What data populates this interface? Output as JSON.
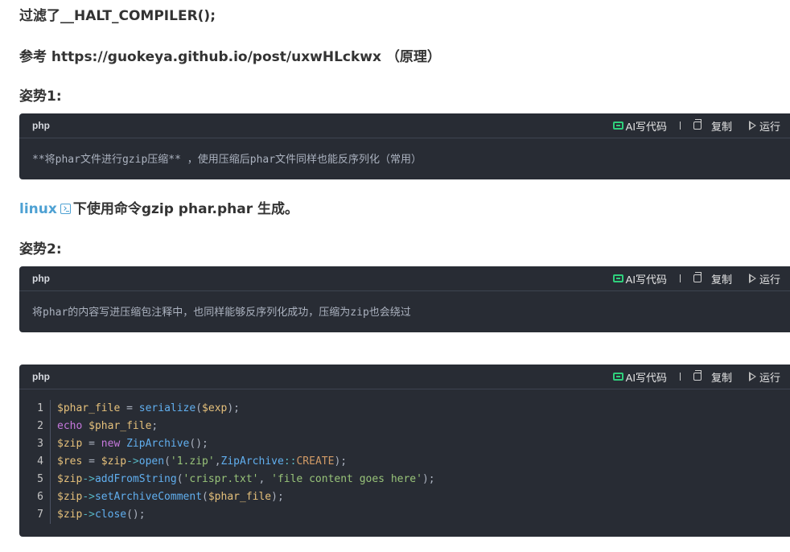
{
  "headings": {
    "h1": "过滤了__HALT_COMPILER();",
    "h2": "参考 https://guokeya.github.io/post/uxwHLckwx （原理）",
    "h3": "姿势1:",
    "h4_link": "linux",
    "h4_rest": "下使用命令gzip phar.phar 生成。",
    "h5": "姿势2:"
  },
  "toolbar": {
    "ai_label": "AI写代码",
    "copy_label": "复制",
    "run_label": "运行"
  },
  "code_blocks": [
    {
      "lang": "php",
      "text": "**将phar文件进行gzip压缩** ，使用压缩后phar文件同样也能反序列化（常用）"
    },
    {
      "lang": "php",
      "text": "将phar的内容写进压缩包注释中，也同样能够反序列化成功，压缩为zip也会绕过"
    },
    {
      "lang": "php",
      "line_numbers": [
        "1",
        "2",
        "3",
        "4",
        "5",
        "6",
        "7"
      ],
      "lines": [
        "$phar_file = serialize($exp);",
        "echo $phar_file;",
        "$zip = new ZipArchive();",
        "$res = $zip->open('1.zip',ZipArchive::CREATE);",
        "$zip->addFromString('crispr.txt', 'file content goes here');",
        "$zip->setArchiveComment($phar_file);",
        "$zip->close();"
      ]
    }
  ],
  "colors": {
    "code_bg": "#282c34",
    "link": "#4ea1d3",
    "ai_icon": "#2fd07c"
  },
  "icons": [
    "terminal-icon",
    "ai-code-icon",
    "copy-icon",
    "run-icon"
  ]
}
